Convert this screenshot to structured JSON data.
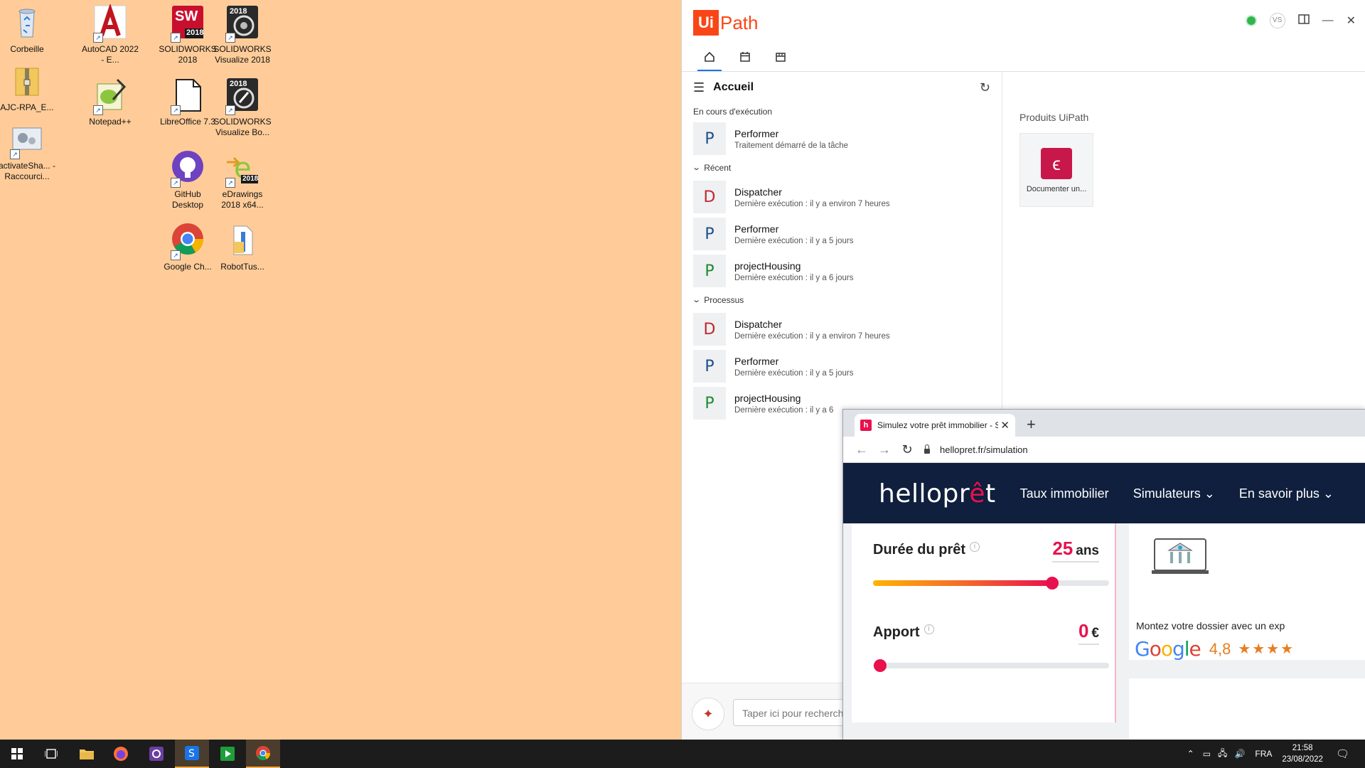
{
  "desktop": {
    "icons": [
      {
        "label": "Corbeille"
      },
      {
        "label": "AJC-RPA_E..."
      },
      {
        "label": "activateSha... - Raccourci..."
      },
      {
        "label": "AutoCAD 2022 - E..."
      },
      {
        "label": "Notepad++"
      },
      {
        "label": "SOLIDWORKS 2018"
      },
      {
        "label": "LibreOffice 7.3"
      },
      {
        "label": "GitHub Desktop"
      },
      {
        "label": "Google Ch..."
      },
      {
        "label": "SOLIDWORKS Visualize 2018"
      },
      {
        "label": "SOLIDWORKS Visualize Bo..."
      },
      {
        "label": "eDrawings 2018 x64..."
      },
      {
        "label": "RobotTus..."
      }
    ],
    "badges": {
      "sw": "SW",
      "year": "2018"
    }
  },
  "uipath": {
    "logo_ui": "Ui",
    "logo_path": "Path",
    "user_initials": "VS",
    "home": {
      "title": "Accueil",
      "running_label": "En cours d'exécution",
      "running": [
        {
          "initial": "P",
          "name": "Performer",
          "sub": "Traitement démarré de la tâche",
          "color": "#1f4e8c"
        }
      ],
      "recent_label": "Récent",
      "recent": [
        {
          "initial": "D",
          "name": "Dispatcher",
          "sub": "Dernière exécution : il y a environ 7 heures",
          "color": "#c0282d"
        },
        {
          "initial": "P",
          "name": "Performer",
          "sub": "Dernière exécution : il y a 5 jours",
          "color": "#1f4e8c"
        },
        {
          "initial": "P",
          "name": "projectHousing",
          "sub": "Dernière exécution : il y a 6 jours",
          "color": "#1e8a2e"
        }
      ],
      "processes_label": "Processus",
      "processes": [
        {
          "initial": "D",
          "name": "Dispatcher",
          "sub": "Dernière exécution : il y a environ 7 heures",
          "color": "#c0282d"
        },
        {
          "initial": "P",
          "name": "Performer",
          "sub": "Dernière exécution : il y a 5 jours",
          "color": "#1f4e8c"
        },
        {
          "initial": "P",
          "name": "projectHousing",
          "sub": "Dernière exécution : il y a 6",
          "color": "#1e8a2e"
        }
      ]
    },
    "products": {
      "label": "Produits UiPath",
      "card_label": "Documenter un..."
    },
    "search_placeholder": "Taper ici pour recherch"
  },
  "browser": {
    "tab_title": "Simulez votre prêt immobilier - S",
    "tab_favicon": "h",
    "url": "hellopret.fr/simulation",
    "site": {
      "logo": "helloprêt",
      "nav": [
        "Taux immobilier",
        "Simulateurs",
        "En savoir plus"
      ],
      "duree_label": "Durée du prêt",
      "duree_value": "25",
      "duree_unit": "ans",
      "duree_fraction": 0.76,
      "apport_label": "Apport",
      "apport_value": "0",
      "apport_unit": "€",
      "apport_fraction": 0.03,
      "side_text": "Montez votre dossier avec un exp",
      "google": "Google",
      "rating": "4,8",
      "stars": "★★★★"
    }
  },
  "taskbar": {
    "lang": "FRA",
    "time": "21:58",
    "date": "23/08/2022"
  }
}
